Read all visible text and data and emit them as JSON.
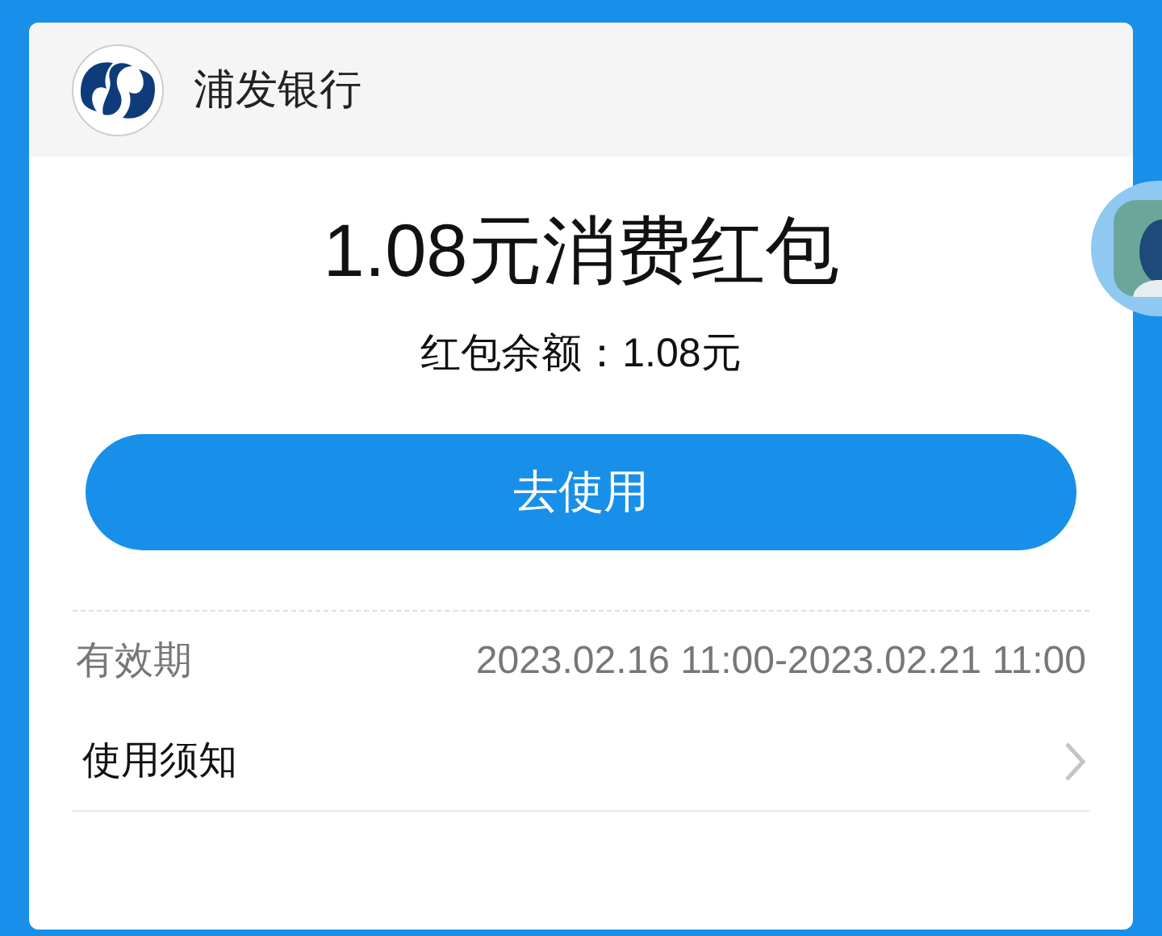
{
  "header": {
    "bank_name": "浦发银行"
  },
  "coupon": {
    "title": "1.08元消费红包",
    "balance": "红包余额：1.08元",
    "use_button": "去使用"
  },
  "details": [
    {
      "kind": "info",
      "label": "有效期",
      "value": "2023.02.16 11:00-2023.02.21 11:00"
    },
    {
      "kind": "link",
      "label": "使用须知"
    }
  ]
}
